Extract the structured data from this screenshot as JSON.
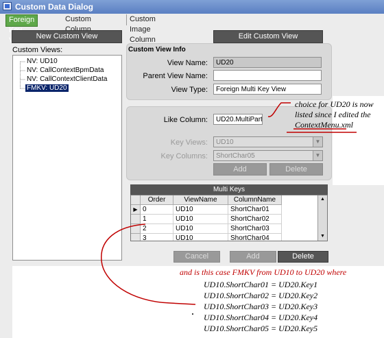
{
  "window": {
    "title": "Custom Data Dialog"
  },
  "tabs": [
    {
      "label": "Foreign Key View",
      "active": true
    },
    {
      "label": "Custom Column Like",
      "active": false
    },
    {
      "label": "Custom Image Column",
      "active": false
    }
  ],
  "left": {
    "new_button": "New Custom View",
    "views_label": "Custom Views:",
    "tree": [
      {
        "label": "NV: UD10",
        "selected": false
      },
      {
        "label": "NV: CallContextBpmData",
        "selected": false
      },
      {
        "label": "NV: CallContextClientData",
        "selected": false
      },
      {
        "label": "FMKV: UD20",
        "selected": true
      }
    ]
  },
  "right": {
    "edit_button": "Edit Custom View",
    "info": {
      "heading": "Custom View Info",
      "view_name_label": "View Name:",
      "view_name_value": "UD20",
      "parent_view_label": "Parent View Name:",
      "parent_view_value": "",
      "view_type_label": "View Type:",
      "view_type_value": "Foreign Multi Key View"
    },
    "like": {
      "like_column_label": "Like Column:",
      "like_column_value": "UD20.MultiPartKey",
      "key_views_label": "Key Views:",
      "key_views_value": "UD10",
      "key_columns_label": "Key Columns:",
      "key_columns_value": "ShortChar05",
      "add_label": "Add",
      "delete_label": "Delete"
    },
    "multi_keys": {
      "title": "Multi Keys",
      "columns": [
        "Order",
        "ViewName",
        "ColumnName"
      ],
      "rows": [
        [
          "0",
          "UD10",
          "ShortChar01"
        ],
        [
          "1",
          "UD10",
          "ShortChar02"
        ],
        [
          "2",
          "UD10",
          "ShortChar03"
        ],
        [
          "3",
          "UD10",
          "ShortChar04"
        ]
      ]
    },
    "bottom_buttons": {
      "cancel": "Cancel",
      "add": "Add",
      "delete": "Delete"
    }
  },
  "annotations": {
    "note_line1": "choice for UD20 is now",
    "note_line2": "listed since I edited the",
    "note_line3": "ContextMenu.xml",
    "case_line": "and is this case FMKV from UD10 to UD20 where",
    "mappings": [
      "UD10.ShortChar01 = UD20.Key1",
      "UD10.ShortChar02 = UD20.Key2",
      "UD10.ShortChar03 = UD20.Key3",
      "UD10.ShortChar04 = UD20.Key4",
      "UD10.ShortChar05 = UD20.Key5"
    ]
  },
  "colors": {
    "active_tab": "#5fa84a",
    "dark_button": "#555555",
    "selection": "#0a246a",
    "annotation_red": "#c00000"
  }
}
